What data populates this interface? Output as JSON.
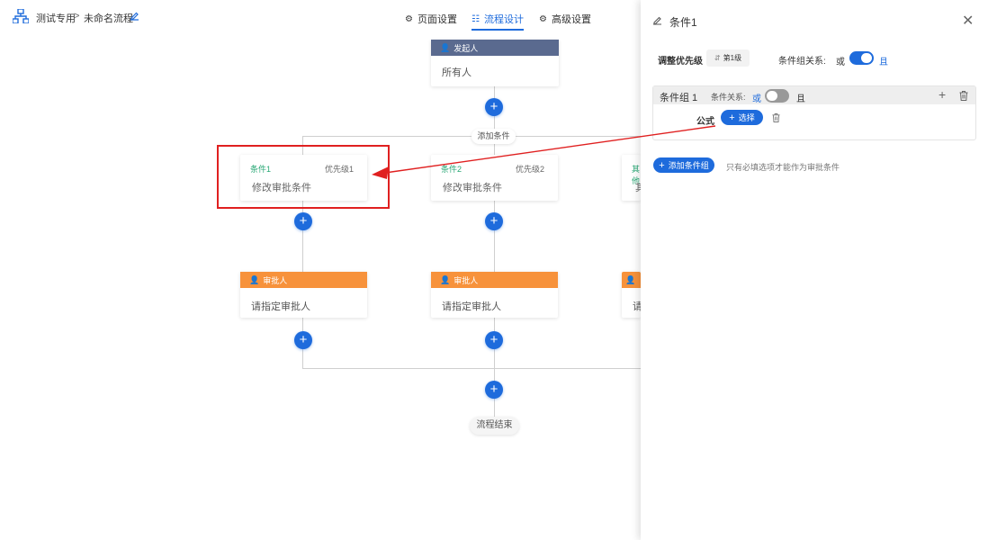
{
  "header": {
    "app_name": "测试专用",
    "separator": ">",
    "flow_name": "未命名流程",
    "tabs": [
      {
        "label": "页面设置",
        "active": false
      },
      {
        "label": "流程设计",
        "active": true
      },
      {
        "label": "高级设置",
        "active": false
      }
    ]
  },
  "flow": {
    "start": {
      "header": "发起人",
      "body": "所有人"
    },
    "add_condition": "添加条件",
    "conditions": [
      {
        "title": "条件1",
        "priority": "优先级1",
        "body": "修改审批条件"
      },
      {
        "title": "条件2",
        "priority": "优先级2",
        "body": "修改审批条件"
      },
      {
        "title": "其他",
        "priority": "",
        "body": "其"
      }
    ],
    "approvers": [
      {
        "header": "审批人",
        "body": "请指定审批人"
      },
      {
        "header": "审批人",
        "body": "请指定审批人"
      },
      {
        "header": "审批人",
        "body": "请"
      }
    ],
    "end": "流程结束"
  },
  "panel": {
    "title": "条件1",
    "priority_label": "调整优先级",
    "priority_value": "第1级",
    "group_relation_label": "条件组关系:",
    "group_relation_or": "或",
    "group_relation_and": "且",
    "group": {
      "name": "条件组 1",
      "relation_label": "条件关系:",
      "relation_or": "或",
      "relation_and": "且",
      "field_label": "公式",
      "select_button": "选择"
    },
    "add_group_button": "添加条件组",
    "hint": "只有必填选项才能作为审批条件"
  },
  "colors": {
    "accent": "#1e6bdc",
    "start_header": "#5a6a8f",
    "approver_header": "#f7923b",
    "condition_title": "#2aa876",
    "highlight_red": "#e02020"
  }
}
